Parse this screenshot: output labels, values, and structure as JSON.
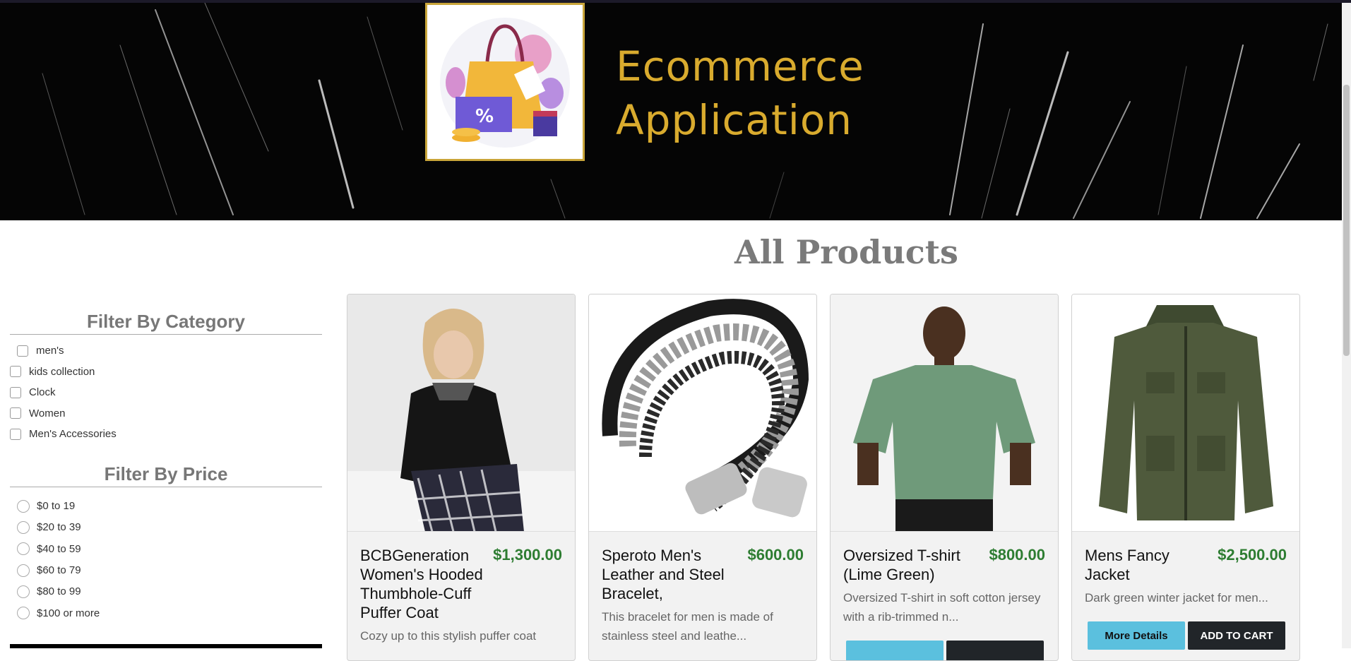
{
  "brand": {
    "line1": "Ecommerce",
    "line2": "Application",
    "logo_icon": "shopping-bag-icon"
  },
  "page_title": "All Products",
  "filters": {
    "category_title": "Filter By Category",
    "categories": [
      "men's",
      "kids collection",
      "Clock",
      "Women",
      "Men's Accessories"
    ],
    "price_title": "Filter By Price",
    "prices": [
      "$0 to 19",
      "$20 to 39",
      "$40 to 59",
      "$60 to 79",
      "$80 to 99",
      "$100 or more"
    ]
  },
  "products": [
    {
      "name": "BCBGeneration Women's Hooded Thumbhole-Cuff Puffer Coat",
      "price": "$1,300.00",
      "description": "Cozy up to this stylish puffer coat",
      "image": "woman-puffer-coat-photo"
    },
    {
      "name": "Speroto Men's Leather and Steel Bracelet,",
      "price": "$600.00",
      "description": "This bracelet for men is made of stainless steel and leathe...",
      "image": "leather-steel-bracelet-photo"
    },
    {
      "name": "Oversized T-shirt (Lime Green)",
      "price": "$800.00",
      "description": "Oversized T-shirt in soft cotton jersey with a rib-trimmed n...",
      "image": "green-tshirt-photo"
    },
    {
      "name": "Mens Fancy Jacket",
      "price": "$2,500.00",
      "description": "Dark green winter jacket for men...",
      "image": "green-jacket-photo",
      "more_label": "More Details",
      "cart_label": "ADD TO CART"
    }
  ],
  "colors": {
    "brand_gold": "#d9ab2e",
    "price_green": "#2e7d32",
    "more_btn": "#5bc0de",
    "cart_btn": "#212529"
  }
}
